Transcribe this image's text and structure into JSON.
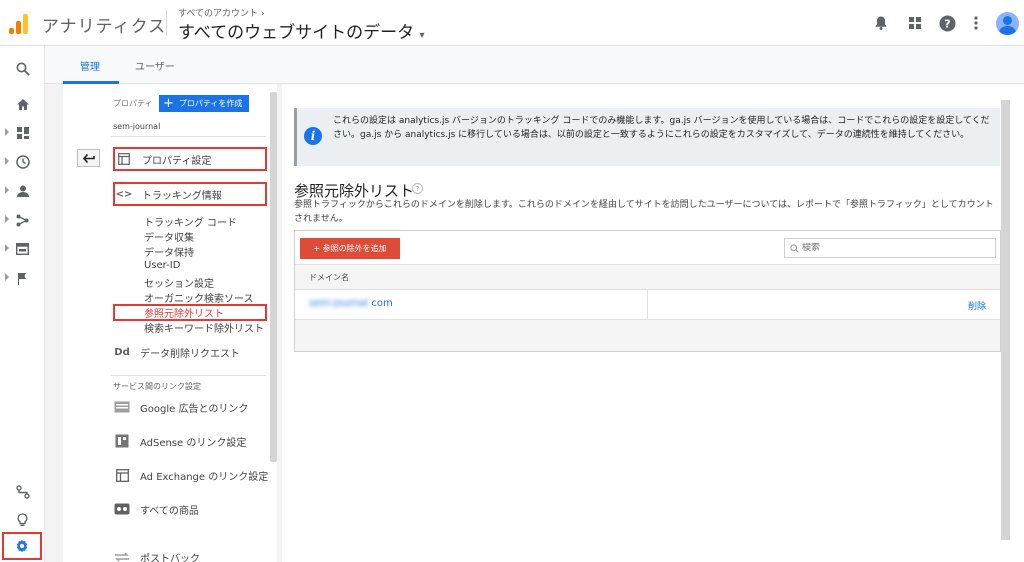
{
  "header": {
    "app_title": "アナリティクス",
    "account_crumb": "すべてのアカウント",
    "property_title": "すべてのウェブサイトのデータ"
  },
  "tabs": [
    {
      "label": "管理",
      "active": true
    },
    {
      "label": "ユーザー",
      "active": false
    }
  ],
  "property": {
    "label": "プロパティ",
    "create_button": "プロパティを作成",
    "name": "sem-journal"
  },
  "nav": {
    "property_settings": "プロパティ設定",
    "tracking_info": "トラッキング情報",
    "sub_items": [
      "トラッキング コード",
      "データ収集",
      "データ保持",
      "User-ID",
      "セッション設定",
      "オーガニック検索ソース",
      "参照元除外リスト",
      "検索キーワード除外リスト"
    ],
    "data_deletion": "データ削除リクエスト",
    "link_section": "サービス間のリンク設定",
    "links": [
      "Google 広告とのリンク",
      "AdSense のリンク設定",
      "Ad Exchange のリンク設定",
      "すべての商品",
      "ポストバック"
    ]
  },
  "info": {
    "text": "これらの設定は analytics.js バージョンのトラッキング コードでのみ機能します。ga.js バージョンを使用している場合は、コードでこれらの設定を設定してください。ga.js から analytics.js に移行している場合は、以前の設定と一致するようにこれらの設定をカスタマイズして、データの連続性を維持してください。"
  },
  "main": {
    "title": "参照元除外リスト",
    "description": "参照トラフィックからこれらのドメインを削除します。これらのドメインを経由してサイトを訪問したユーザーについては、レポートで「参照トラフィック」としてカウントされません。",
    "add_button": "+ 参照の除外を追加",
    "search_placeholder": "検索",
    "column_header": "ドメイン名",
    "rows": [
      {
        "domain_blurred": "sem-journal",
        "domain_suffix": "com",
        "action": "削除"
      }
    ]
  },
  "colors": {
    "accent": "#1a73e8",
    "highlight_box": "#e53935",
    "add_button": "#dd4b39"
  }
}
